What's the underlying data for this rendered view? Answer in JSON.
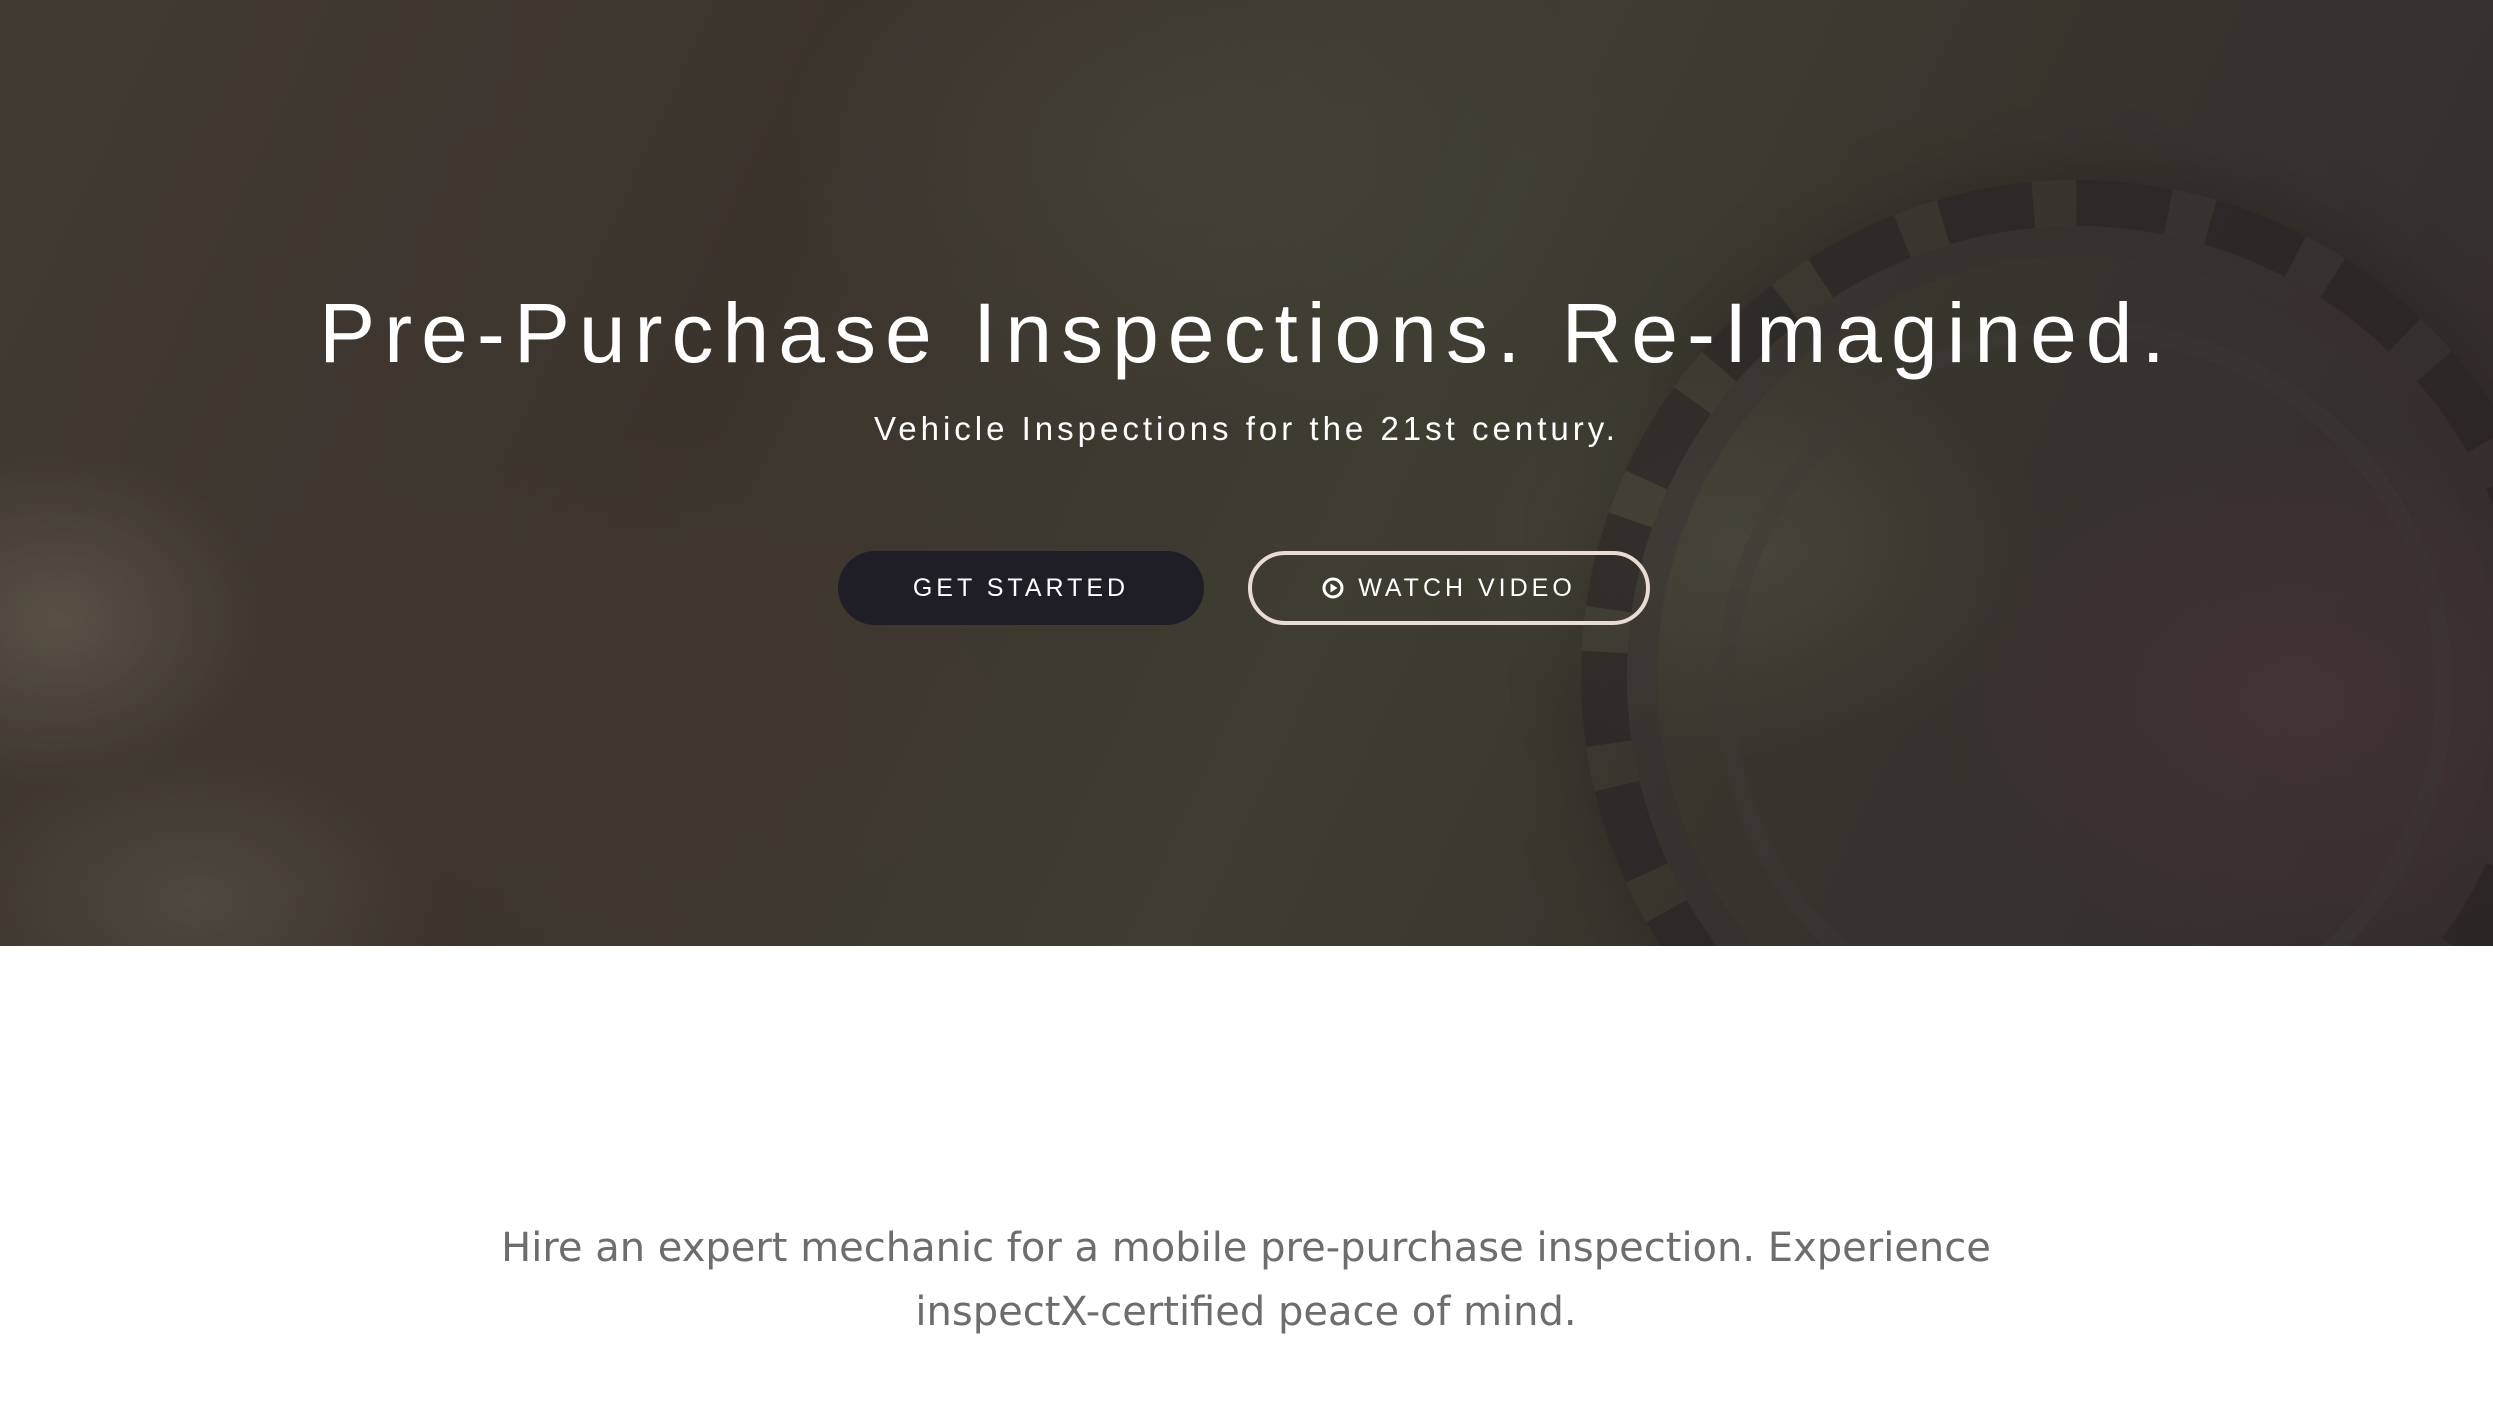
{
  "hero": {
    "title": "Pre-Purchase Inspections. Re-Imagined.",
    "subtitle": "Vehicle Inspections for the 21st century.",
    "buttons": {
      "get_started": "GET STARTED",
      "watch_video": "WATCH VIDEO"
    },
    "icons": {
      "watch_video_icon": "play-circle-icon"
    }
  },
  "intro": {
    "text": "Hire an expert mechanic for a mobile pre-purchase inspection. Experience inspectX-certified peace of mind."
  },
  "colors": {
    "primary_button": "#1f1e27",
    "outline_button_border": "#e9ddd3",
    "body_text": "#6d6d6d",
    "hero_text": "#ffffff"
  }
}
